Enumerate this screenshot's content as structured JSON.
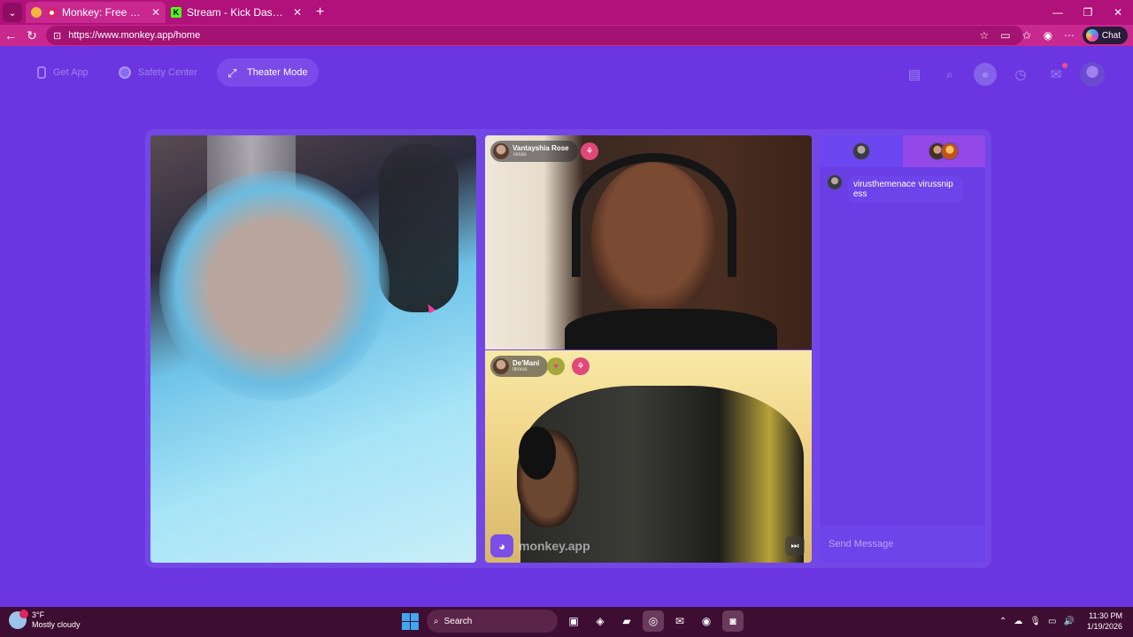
{
  "browser": {
    "tabs": [
      {
        "title": "Monkey: Free Live Video Chat",
        "active": true
      },
      {
        "title": "Stream - Kick Dashboard",
        "active": false
      }
    ],
    "url": "https://www.monkey.app/home",
    "chat_button": "Chat",
    "accent": "#b0117a"
  },
  "nav": {
    "get_app": "Get App",
    "safety_center": "Safety Center",
    "theater_mode": "Theater Mode"
  },
  "videos": {
    "top_right": {
      "name": "Vantayshia Rose",
      "location": "Texas"
    },
    "bottom_right": {
      "name": "De'Mani",
      "location": "Illinois"
    },
    "watermark": "monkey.app"
  },
  "chat": {
    "messages": [
      {
        "text": "virusthemenace virussnipess"
      }
    ],
    "input_placeholder": "Send Message"
  },
  "taskbar": {
    "temperature": "3°F",
    "condition": "Mostly cloudy",
    "search": "Search",
    "time": "11:30 PM",
    "date": "1/19/2026"
  },
  "colors": {
    "page_bg": "#6b36e2",
    "stage_bg": "#7347e6",
    "chat_bg": "#6a3ee5"
  }
}
